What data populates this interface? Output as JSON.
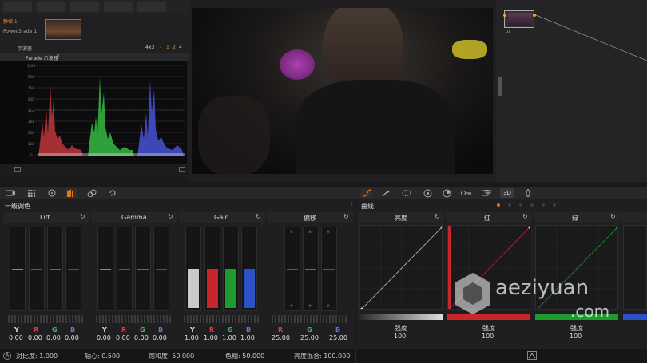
{
  "gallery": {
    "still_label": "静帧 1",
    "grade_label": "PowerGrade 1",
    "ratio": "4x3",
    "pages": [
      "1",
      "2",
      "4"
    ],
    "nav": "-",
    "zoom_label": "示波器"
  },
  "scope": {
    "tab": "Parade 示波器",
    "scale": [
      "1023",
      "896",
      "768",
      "640",
      "512",
      "384",
      "256",
      "128",
      "0"
    ]
  },
  "node": {
    "label": "01"
  },
  "toolbar": {
    "right_3d": "3D"
  },
  "primary": {
    "title": "一级调色",
    "wheels": [
      {
        "name": "Lift",
        "values": [
          "0.00",
          "0.00",
          "0.00",
          "0.00"
        ],
        "keys": [
          "Y",
          "R",
          "G",
          "B"
        ]
      },
      {
        "name": "Gamma",
        "values": [
          "0.00",
          "0.00",
          "0.00",
          "0.00"
        ],
        "keys": [
          "Y",
          "R",
          "G",
          "B"
        ]
      },
      {
        "name": "Gain",
        "values": [
          "1.00",
          "1.00",
          "1.00",
          "1.00"
        ],
        "keys": [
          "Y",
          "R",
          "G",
          "B"
        ]
      },
      {
        "name": "偏移",
        "values": [
          "25.00",
          "25.00",
          "25.00"
        ],
        "keys": [
          "R",
          "G",
          "B"
        ]
      }
    ],
    "gain_levels": [
      0.5,
      0.5,
      0.5,
      0.5
    ]
  },
  "curves": {
    "title": "曲线",
    "panels": [
      {
        "name": "亮度",
        "label": "强度",
        "value": "100"
      },
      {
        "name": "红",
        "label": "强度",
        "value": "100"
      },
      {
        "name": "绿",
        "label": "强度",
        "value": "100"
      }
    ]
  },
  "status": {
    "contrast": "对比度: 1.000",
    "pivot": "轴心: 0.500",
    "saturation": "饱和度: 50.000",
    "hue": "色相: 50.000",
    "lum_mix": "亮度混合: 100.000"
  },
  "watermark": {
    "text": "aeziyuan",
    "sub": ".com"
  },
  "colors": {
    "red": "#c8262a",
    "green": "#1f9a2e",
    "blue": "#2a52c4",
    "accent": "#d46a1c"
  }
}
